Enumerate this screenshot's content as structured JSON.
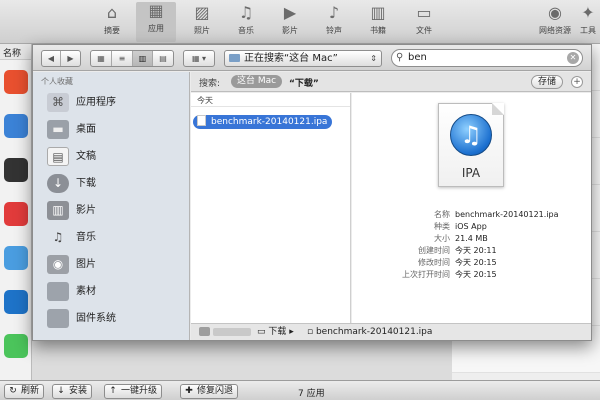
{
  "app_toolbar": {
    "items": [
      {
        "label": "摘要",
        "icon": "home-icon"
      },
      {
        "label": "应用",
        "icon": "apps-icon"
      },
      {
        "label": "照片",
        "icon": "photo-icon"
      },
      {
        "label": "音乐",
        "icon": "music-icon"
      },
      {
        "label": "影片",
        "icon": "video-icon"
      },
      {
        "label": "铃声",
        "icon": "bell-icon"
      },
      {
        "label": "书籍",
        "icon": "book-icon"
      },
      {
        "label": "文件",
        "icon": "folder-icon"
      },
      {
        "label": "网络资源",
        "icon": "globe-icon"
      },
      {
        "label": "工具",
        "icon": "tools-icon"
      }
    ],
    "active": "应用"
  },
  "app_list": {
    "column_header": "名称"
  },
  "bottom_bar": {
    "buttons": [
      {
        "label": "刷新",
        "icon": "refresh-icon"
      },
      {
        "label": "安装",
        "icon": "install-icon"
      },
      {
        "label": "一键升级",
        "icon": "upgrade-icon"
      },
      {
        "label": "修复闪退",
        "icon": "repair-icon"
      }
    ],
    "status": "7 应用"
  },
  "dialog": {
    "path_popup": "正在搜索“这台 Mac”",
    "search_value": "ben",
    "sidebar": {
      "heading": "个人收藏",
      "items": [
        "应用程序",
        "桌面",
        "文稿",
        "下载",
        "影片",
        "音乐",
        "图片",
        "素材",
        "固件系统"
      ]
    },
    "search_bar": {
      "label": "搜索:",
      "scope_active": "这台 Mac",
      "scope_other": "“下载”",
      "save_label": "存储",
      "add_label": "+"
    },
    "results": {
      "group_header": "今天",
      "selected_file": "benchmark-20140121.ipa"
    },
    "preview": {
      "file_type_badge": "IPA",
      "meta": [
        {
          "key": "名称",
          "value": "benchmark-20140121.ipa"
        },
        {
          "key": "种类",
          "value": "iOS App"
        },
        {
          "key": "大小",
          "value": "21.4 MB"
        },
        {
          "key": "创建时间",
          "value": "今天 20:11"
        },
        {
          "key": "修改时间",
          "value": "今天 20:15"
        },
        {
          "key": "上次打开时间",
          "value": "今天 20:15"
        }
      ]
    },
    "path_bar": {
      "segments": [
        "下载",
        "benchmark-20140121.ipa"
      ]
    }
  }
}
